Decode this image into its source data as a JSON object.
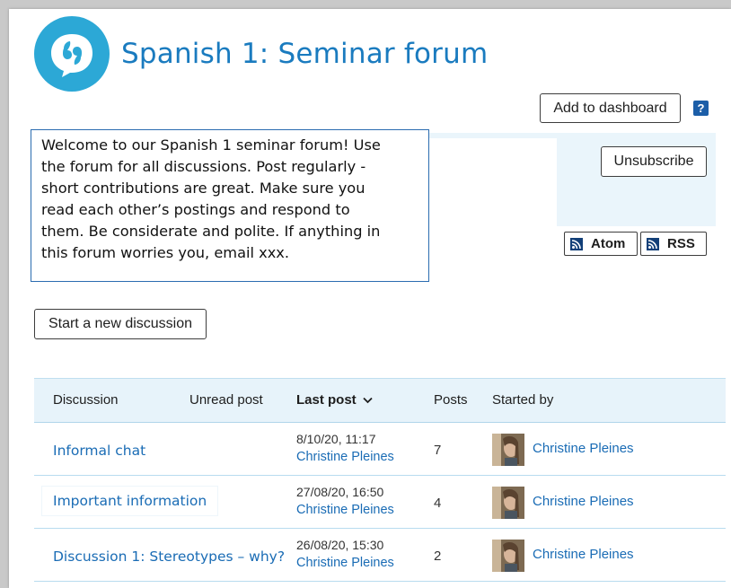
{
  "header": {
    "title": "Spanish 1: Seminar forum",
    "add_to_dashboard": "Add to dashboard",
    "help_label": "?"
  },
  "intro": {
    "lines": [
      "Welcome to our Spanish 1 seminar forum! Use",
      "the forum for all discussions. Post regularly -",
      "short contributions are great. Make sure you",
      "read each other’s postings and respond to",
      "them. Be considerate and polite. If anything in",
      "this forum worries you, email xxx."
    ]
  },
  "actions": {
    "unsubscribe": "Unsubscribe",
    "atom": "Atom",
    "rss": "RSS",
    "start_discussion": "Start a new discussion"
  },
  "table": {
    "headers": {
      "discussion": "Discussion",
      "unread": "Unread post",
      "last_post": "Last post",
      "posts": "Posts",
      "started_by": "Started by"
    },
    "rows": [
      {
        "discussion": "Informal chat",
        "last_post_date": "8/10/20, 11:17",
        "last_post_by": "Christine Pleines",
        "posts": "7",
        "started_by": "Christine Pleines"
      },
      {
        "discussion": "Important information",
        "last_post_date": "27/08/20, 16:50",
        "last_post_by": "Christine Pleines",
        "posts": "4",
        "started_by": "Christine Pleines"
      },
      {
        "discussion": "Discussion 1: Stereotypes – why?",
        "last_post_date": "26/08/20, 15:30",
        "last_post_by": "Christine Pleines",
        "posts": "2",
        "started_by": "Christine Pleines"
      }
    ]
  },
  "icons": {
    "logo": "speech-bubble-quote-icon",
    "feed": "rss-feed-icon",
    "sort": "chevron-down-icon"
  },
  "colors": {
    "brand_blue": "#2ca8d6",
    "title_blue": "#1a7bbf",
    "link_blue": "#1a6cb5",
    "table_header_bg": "#e7f3fa",
    "help_icon_bg": "#1c5ea8"
  }
}
